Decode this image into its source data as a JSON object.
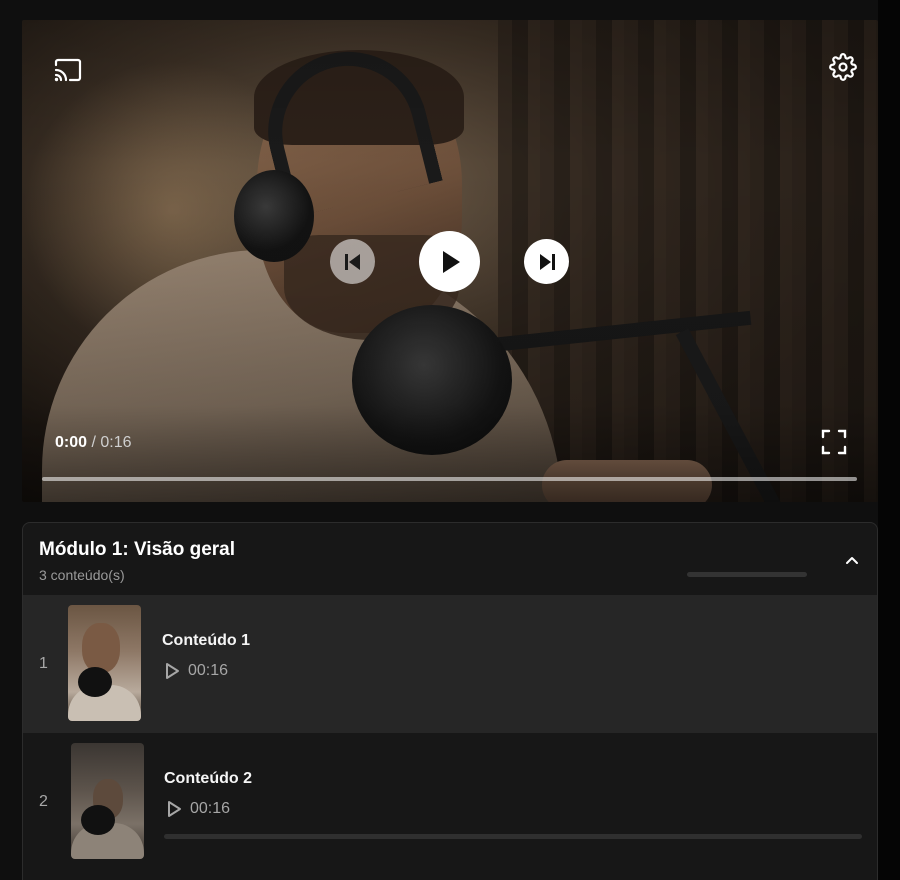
{
  "player": {
    "current_time": "0:00",
    "time_separator": "/",
    "duration": "0:16",
    "progress_fraction": 0,
    "icons": {
      "cast": "cast-icon",
      "settings": "gear-icon",
      "previous": "skip-previous-icon",
      "play": "play-icon",
      "next": "skip-next-icon",
      "fullscreen": "fullscreen-icon"
    }
  },
  "module": {
    "title": "Módulo 1: Visão geral",
    "count": "3 conteúdo(s)",
    "progress_fraction": 0,
    "collapse_icon": "chevron-up-icon",
    "lessons": [
      {
        "index": "1",
        "title": "Conteúdo 1",
        "duration": "00:16",
        "active": true,
        "progress_fraction": null
      },
      {
        "index": "2",
        "title": "Conteúdo 2",
        "duration": "00:16",
        "active": false,
        "progress_fraction": 0
      }
    ]
  },
  "colors": {
    "page_bg": "#0f0f0f",
    "panel_bg": "#171717",
    "active_row_bg": "#262626",
    "text_primary": "#ffffff",
    "text_secondary": "#9a9a9a"
  }
}
